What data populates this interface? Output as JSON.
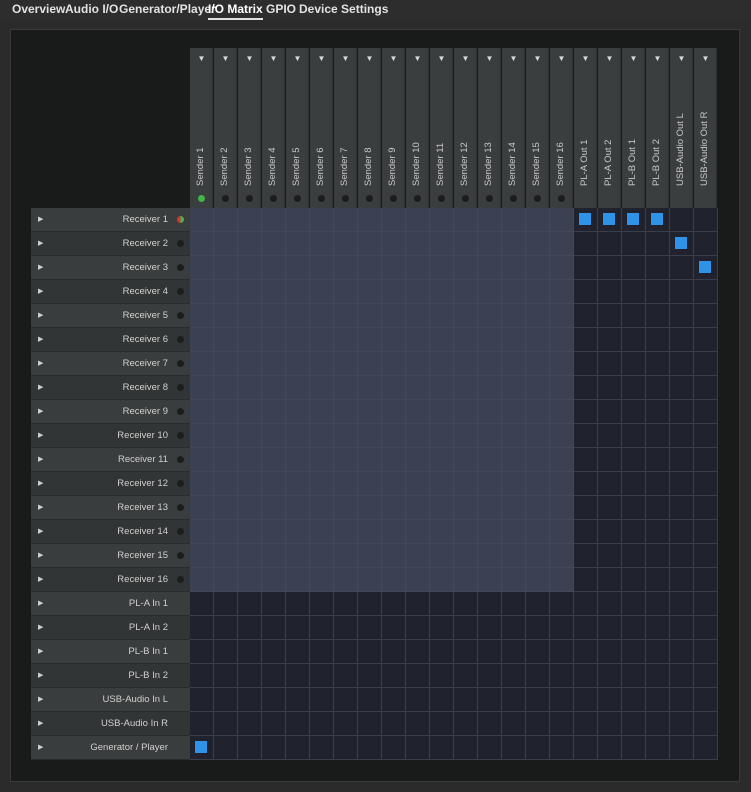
{
  "tabs": [
    {
      "label": "Overview",
      "active": false
    },
    {
      "label": "Audio I/O",
      "active": false
    },
    {
      "label": "Generator/Player",
      "active": false
    },
    {
      "label": "I/O Matrix",
      "active": true
    },
    {
      "label": "GPIO",
      "active": false
    },
    {
      "label": "Device Settings",
      "active": false
    }
  ],
  "matrix": {
    "columns": [
      {
        "label": "Sender 1",
        "status": "green"
      },
      {
        "label": "Sender 2",
        "status": "off"
      },
      {
        "label": "Sender 3",
        "status": "off"
      },
      {
        "label": "Sender 4",
        "status": "off"
      },
      {
        "label": "Sender 5",
        "status": "off"
      },
      {
        "label": "Sender 6",
        "status": "off"
      },
      {
        "label": "Sender 7",
        "status": "off"
      },
      {
        "label": "Sender 8",
        "status": "off"
      },
      {
        "label": "Sender 9",
        "status": "off"
      },
      {
        "label": "Sender 10",
        "status": "off"
      },
      {
        "label": "Sender 11",
        "status": "off"
      },
      {
        "label": "Sender 12",
        "status": "off"
      },
      {
        "label": "Sender 13",
        "status": "off"
      },
      {
        "label": "Sender 14",
        "status": "off"
      },
      {
        "label": "Sender 15",
        "status": "off"
      },
      {
        "label": "Sender 16",
        "status": "off"
      },
      {
        "label": "PL-A Out 1",
        "status": "none"
      },
      {
        "label": "PL-A Out 2",
        "status": "none"
      },
      {
        "label": "PL-B Out 1",
        "status": "none"
      },
      {
        "label": "PL-B Out 2",
        "status": "none"
      },
      {
        "label": "USB-Audio Out L",
        "status": "none"
      },
      {
        "label": "USB-Audio Out R",
        "status": "none"
      }
    ],
    "rows": [
      {
        "label": "Receiver 1",
        "status": "red-green"
      },
      {
        "label": "Receiver 2",
        "status": "off"
      },
      {
        "label": "Receiver 3",
        "status": "off"
      },
      {
        "label": "Receiver 4",
        "status": "off"
      },
      {
        "label": "Receiver 5",
        "status": "off"
      },
      {
        "label": "Receiver 6",
        "status": "off"
      },
      {
        "label": "Receiver 7",
        "status": "off"
      },
      {
        "label": "Receiver 8",
        "status": "off"
      },
      {
        "label": "Receiver 9",
        "status": "off"
      },
      {
        "label": "Receiver 10",
        "status": "off"
      },
      {
        "label": "Receiver 11",
        "status": "off"
      },
      {
        "label": "Receiver 12",
        "status": "off"
      },
      {
        "label": "Receiver 13",
        "status": "off"
      },
      {
        "label": "Receiver 14",
        "status": "off"
      },
      {
        "label": "Receiver 15",
        "status": "off"
      },
      {
        "label": "Receiver 16",
        "status": "off"
      },
      {
        "label": "PL-A In 1",
        "status": "none"
      },
      {
        "label": "PL-A In 2",
        "status": "none"
      },
      {
        "label": "PL-B In 1",
        "status": "none"
      },
      {
        "label": "PL-B In 2",
        "status": "none"
      },
      {
        "label": "USB-Audio In L",
        "status": "none"
      },
      {
        "label": "USB-Audio In R",
        "status": "none"
      },
      {
        "label": "Generator / Player",
        "status": "none"
      }
    ],
    "connections": [
      [
        0,
        16
      ],
      [
        0,
        17
      ],
      [
        0,
        18
      ],
      [
        0,
        19
      ],
      [
        1,
        20
      ],
      [
        2,
        21
      ],
      [
        22,
        0
      ]
    ],
    "colors": {
      "connection": "#2f93e8",
      "status_green": "#3fb54a",
      "status_red": "#d83232"
    }
  },
  "icons": {
    "column_dropdown": "chevron-down-icon",
    "row_expand": "chevron-right-icon"
  }
}
